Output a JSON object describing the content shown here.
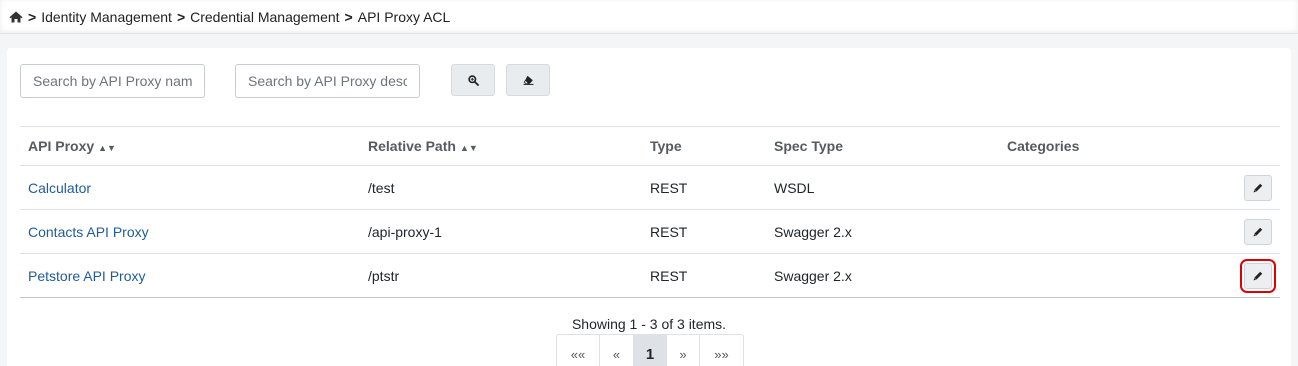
{
  "breadcrumb": {
    "items": [
      "Identity Management",
      "Credential Management",
      "API Proxy ACL"
    ],
    "separator": ">"
  },
  "filters": {
    "name_placeholder": "Search by API Proxy name",
    "desc_placeholder": "Search by API Proxy description"
  },
  "table": {
    "headers": {
      "proxy": "API Proxy",
      "path": "Relative Path",
      "type": "Type",
      "spec": "Spec Type",
      "categories": "Categories"
    },
    "rows": [
      {
        "proxy": "Calculator",
        "path": "/test",
        "type": "REST",
        "spec": "WSDL",
        "categories": ""
      },
      {
        "proxy": "Contacts API Proxy",
        "path": "/api-proxy-1",
        "type": "REST",
        "spec": "Swagger 2.x",
        "categories": ""
      },
      {
        "proxy": "Petstore API Proxy",
        "path": "/ptstr",
        "type": "REST",
        "spec": "Swagger 2.x",
        "categories": ""
      }
    ]
  },
  "pagination": {
    "summary": "Showing 1 - 3 of 3 items.",
    "first": "««",
    "prev": "«",
    "current": "1",
    "next": "»",
    "last": "»»"
  },
  "colors": {
    "link": "#1f5c99",
    "highlight": "#e00000"
  }
}
